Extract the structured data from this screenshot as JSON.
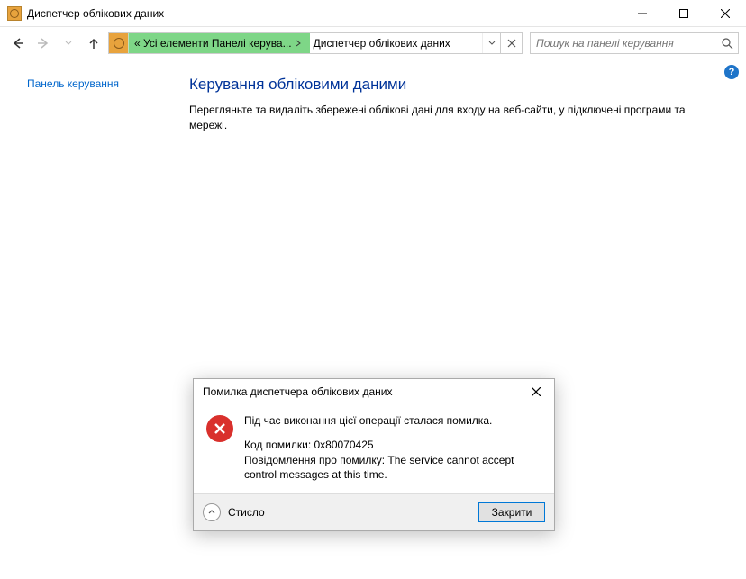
{
  "window": {
    "title": "Диспетчер облікових даних"
  },
  "address": {
    "segment1_prefix": "«",
    "segment1": "Усі елементи Панелі керува...",
    "segment2": "Диспетчер облікових даних"
  },
  "search": {
    "placeholder": "Пошук на панелі керування"
  },
  "sidebar": {
    "link": "Панель керування"
  },
  "main": {
    "heading": "Керування обліковими даними",
    "description": "Перегляньте та видаліть збережені облікові дані для входу на веб-сайти, у підключені програми та мережі."
  },
  "dialog": {
    "title": "Помилка диспетчера облікових даних",
    "message": "Під час виконання цієї операції сталася помилка.",
    "code_line": "Код помилки: 0x80070425",
    "detail_line": "Повідомлення про помилку: The service cannot accept control messages at this time.",
    "details_toggle": "Стисло",
    "close_button": "Закрити"
  }
}
